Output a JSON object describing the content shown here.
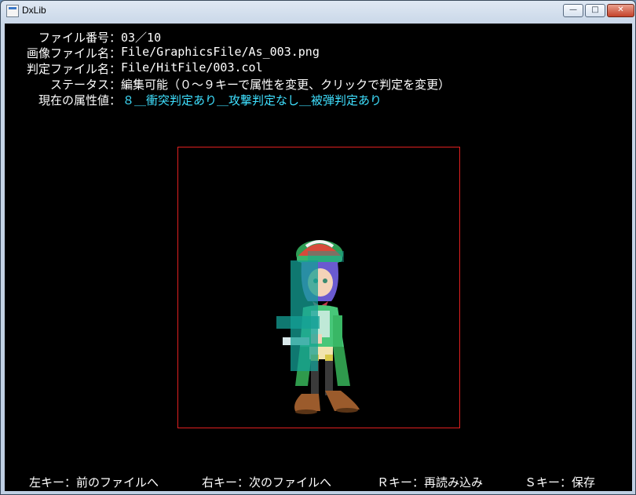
{
  "window": {
    "title": "DxLib",
    "controls": {
      "minimize": "—",
      "maximize": "□",
      "close": "✕"
    }
  },
  "info": {
    "file_no_label": "ファイル番号：",
    "file_no_value": "03／10",
    "image_file_label": "画像ファイル名：",
    "image_file_value": "File/GraphicsFile/As_003.png",
    "hit_file_label": "判定ファイル名：",
    "hit_file_value": "File/HitFile/003.col",
    "status_label": "ステータス：",
    "status_value": "編集可能（０～９キーで属性を変更、クリックで判定を変更）",
    "attr_label": "現在の属性値：",
    "attr_value": "８＿衝突判定あり＿攻撃判定なし＿被弾判定あり"
  },
  "footer": {
    "prev": "左キー：前のファイルへ",
    "next": "右キー：次のファイルへ",
    "reload": "Ｒキー：再読み込み",
    "save": "Ｓキー：保存"
  },
  "colors": {
    "background": "#000000",
    "text": "#ffffff",
    "attribute_text": "#3fe0ff",
    "bounds_border": "#e02020",
    "hitbox": "#14a096"
  }
}
